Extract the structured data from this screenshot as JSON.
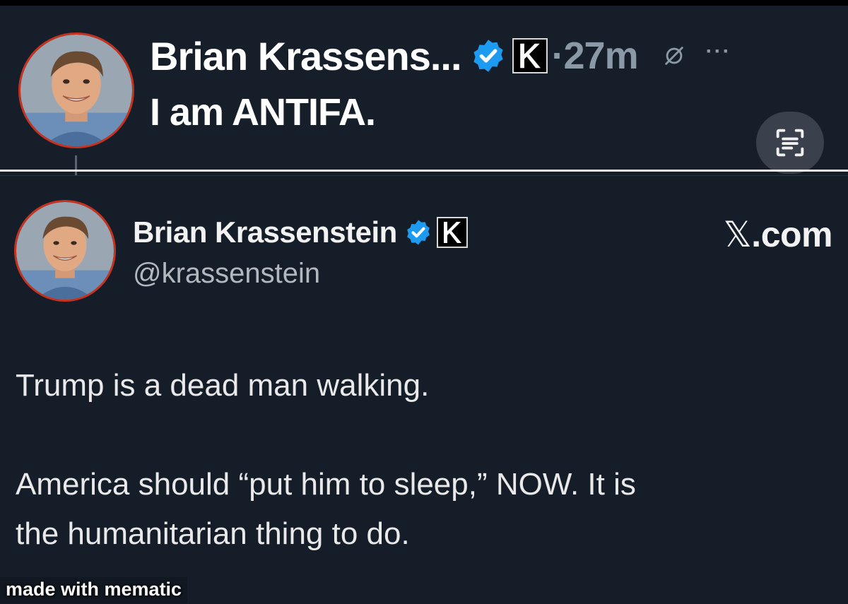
{
  "post": {
    "display_name": "Brian Krassens...",
    "time": "·27m",
    "text": "I am ANTIFA."
  },
  "quoted_tweet": {
    "display_name": "Brian Krassenstein",
    "handle": "@krassenstein",
    "source_x": "𝕏",
    "source_domain": ".com",
    "body_lines": [
      "Trump is a dead man walking.",
      "America should “put him to sleep,” NOW.  It is",
      "the humanitarian thing to do."
    ]
  },
  "watermark": "made with mematic",
  "icons": {
    "verified": "verified-badge-icon",
    "k": "k-logo-badge-icon",
    "grok": "grok-icon",
    "more": "more-options-icon",
    "scan": "scan-text-icon"
  },
  "colors": {
    "background": "#141c26",
    "verified_blue": "#1d9bf0",
    "avatar_ring": "#c7321f",
    "muted_text": "#8b98a5"
  }
}
